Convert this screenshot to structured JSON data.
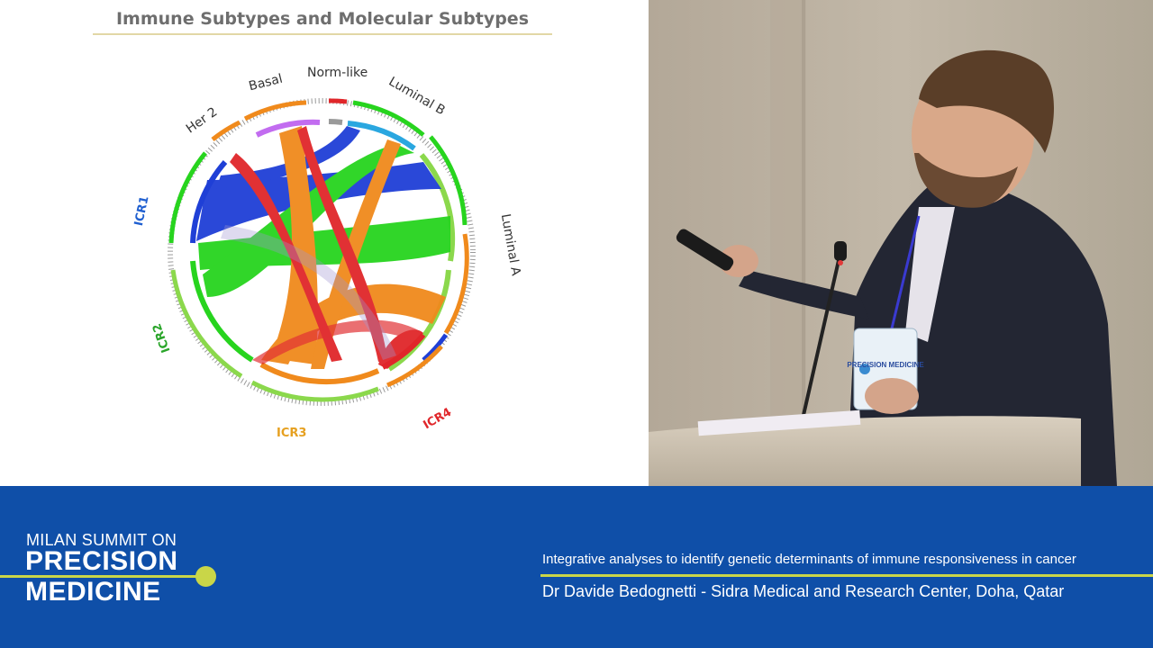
{
  "slide": {
    "title": "Immune Subtypes and Molecular Subtypes",
    "segment_labels": [
      "Basal",
      "Norm-like",
      "Luminal B",
      "Her 2",
      "Luminal A",
      "ICR1",
      "ICR2",
      "ICR3",
      "ICR4"
    ],
    "colors": {
      "icr1": "#1f3fd6",
      "icr2": "#27d41e",
      "icr3": "#f08a1c",
      "icr4": "#e0262a"
    }
  },
  "video": {
    "badge_text": "PRECISION MEDICINE"
  },
  "banner": {
    "logo_line1": "MILAN SUMMIT ON",
    "logo_line2": "PRECISION",
    "logo_line3": "MEDICINE",
    "talk_title": "Integrative analyses to identify genetic determinants of immune responsiveness in cancer",
    "speaker": "Dr Davide Bedognetti - Sidra Medical and Research Center, Doha, Qatar",
    "accent_color": "#c9d648",
    "background_color": "#0f4fa8"
  }
}
